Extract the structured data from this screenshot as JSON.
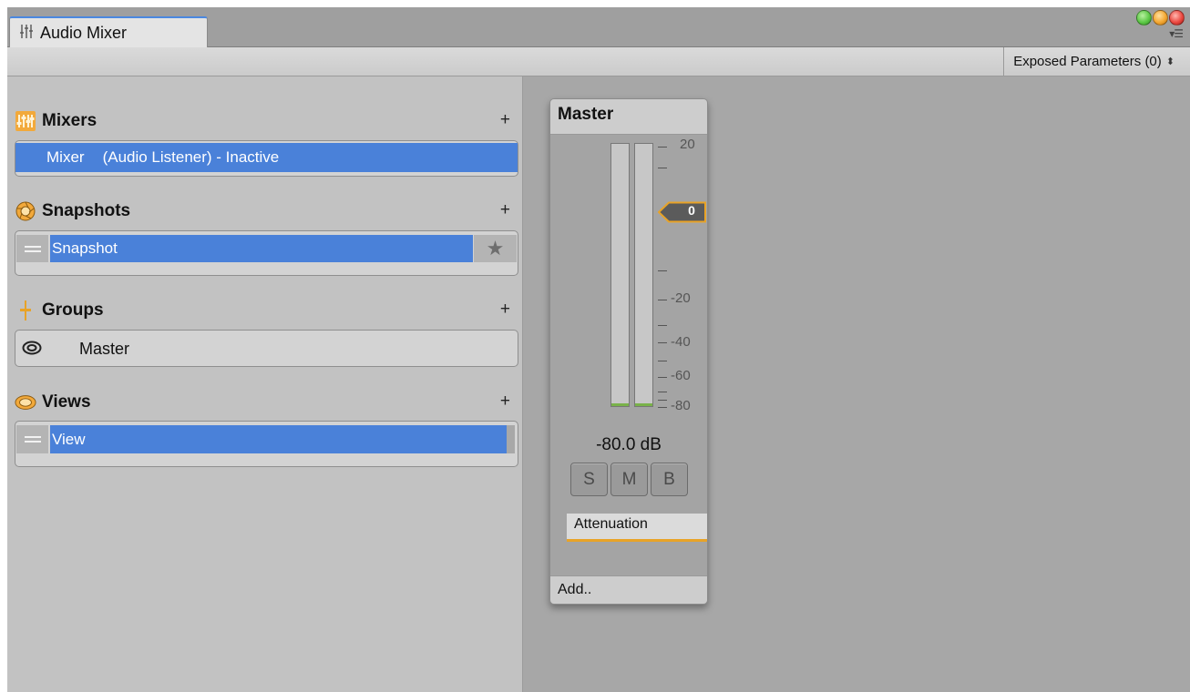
{
  "window": {
    "tab_label": "Audio Mixer",
    "traffic_light_colors": [
      "#5ec947",
      "#f4a832",
      "#ec4a42"
    ]
  },
  "toolbar": {
    "exposed_parameters_label": "Exposed Parameters (0)"
  },
  "sections": {
    "mixers": {
      "title": "Mixers",
      "add_label": "+",
      "icon": "mixer-icon",
      "item": {
        "name": "Mixer",
        "detail": "(Audio Listener) - Inactive"
      }
    },
    "snapshots": {
      "title": "Snapshots",
      "add_label": "+",
      "icon": "snapshot-aperture-icon",
      "item": {
        "name": "Snapshot",
        "star_icon": "star-icon"
      }
    },
    "groups": {
      "title": "Groups",
      "add_label": "+",
      "icon": "fader-icon",
      "item": {
        "name": "Master",
        "visibility_icon": "eye-icon"
      }
    },
    "views": {
      "title": "Views",
      "add_label": "+",
      "icon": "eye-icon",
      "item": {
        "name": "View"
      }
    }
  },
  "strip": {
    "name": "Master",
    "scale_labels": [
      "20",
      "-20",
      "-40",
      "-60",
      "-80"
    ],
    "fader_value": "0",
    "db_readout": "-80.0 dB",
    "buttons": [
      "S",
      "M",
      "B"
    ],
    "effect": "Attenuation",
    "add_label": "Add.."
  },
  "colors": {
    "selection": "#4a81d9",
    "accent": "#e8a327",
    "meter_floor": "#79b24a"
  }
}
